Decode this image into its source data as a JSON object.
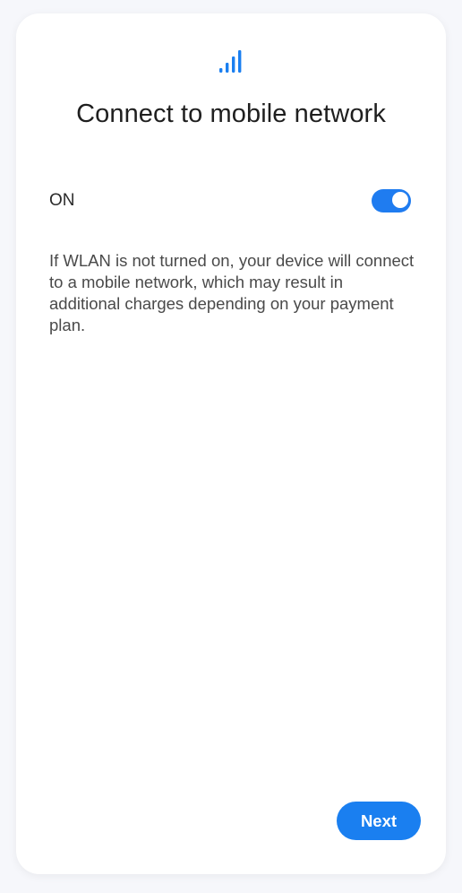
{
  "screen": {
    "title": "Connect to mobile network",
    "signal_icon": "signal-bars-icon",
    "accent_color": "#1a7ff0"
  },
  "mobile_data": {
    "label": "ON",
    "toggle_state": "on"
  },
  "description": "If WLAN is not turned on, your device will connect to a mobile network, which may result in additional charges depending on your payment plan.",
  "footer": {
    "next_label": "Next"
  }
}
